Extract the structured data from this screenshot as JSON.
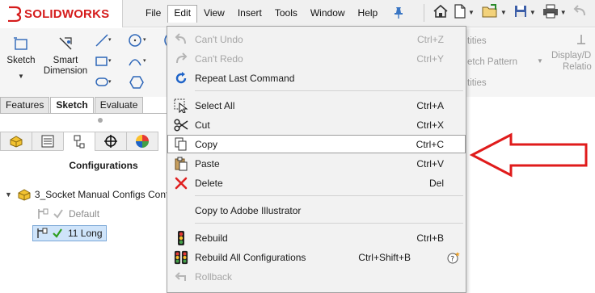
{
  "app": {
    "brand_prefix": "3DS",
    "brand": "SOLIDWORKS"
  },
  "menubar": [
    "File",
    "Edit",
    "View",
    "Insert",
    "Tools",
    "Window",
    "Help"
  ],
  "menubar_open": "Edit",
  "command_manager": {
    "sketch_label": "Sketch",
    "smart_dimension_label": "Smart Dimension",
    "faded_right_1": "tities",
    "faded_right_2": "etch Pattern",
    "faded_right_3": "tities",
    "display_label_1": "Display/D",
    "display_label_2": "Relatio"
  },
  "tabs": [
    "Features",
    "Sketch",
    "Evaluate"
  ],
  "active_tab": "Sketch",
  "panel": {
    "title": "Configurations",
    "root": "3_Socket Manual Configs Conf",
    "children": [
      {
        "label": "Default",
        "state": "inactive"
      },
      {
        "label": "11 Long",
        "state": "active"
      }
    ]
  },
  "edit_menu": {
    "items": [
      {
        "label": "Can't Undo",
        "shortcut": "Ctrl+Z",
        "icon": "undo-icon",
        "enabled": false
      },
      {
        "label": "Can't Redo",
        "shortcut": "Ctrl+Y",
        "icon": "redo-icon",
        "enabled": false
      },
      {
        "label": "Repeat Last Command",
        "shortcut": "",
        "icon": "repeat-icon",
        "enabled": true
      },
      {
        "label": "Select All",
        "shortcut": "Ctrl+A",
        "icon": "select-all-icon",
        "enabled": true
      },
      {
        "label": "Cut",
        "shortcut": "Ctrl+X",
        "icon": "scissors-icon",
        "enabled": true
      },
      {
        "label": "Copy",
        "shortcut": "Ctrl+C",
        "icon": "copy-icon",
        "enabled": true,
        "hovered": true
      },
      {
        "label": "Paste",
        "shortcut": "Ctrl+V",
        "icon": "paste-icon",
        "enabled": true
      },
      {
        "label": "Delete",
        "shortcut": "Del",
        "icon": "delete-icon",
        "enabled": true
      },
      {
        "label": "Copy to Adobe Illustrator",
        "shortcut": "",
        "icon": "",
        "enabled": true
      },
      {
        "label": "Rebuild",
        "shortcut": "Ctrl+B",
        "icon": "traffic-light-icon",
        "enabled": true
      },
      {
        "label": "Rebuild All Configurations",
        "shortcut": "Ctrl+Shift+B",
        "icon": "traffic-lights-icon",
        "enabled": true
      },
      {
        "label": "Rollback",
        "shortcut": "",
        "icon": "rollback-icon",
        "enabled": false
      }
    ]
  },
  "colors": {
    "brand_red": "#d51c1c",
    "annotation_arrow": "#e01b1b",
    "selection_blue": "#cfe4fa",
    "check_green": "#2e9e1f"
  }
}
